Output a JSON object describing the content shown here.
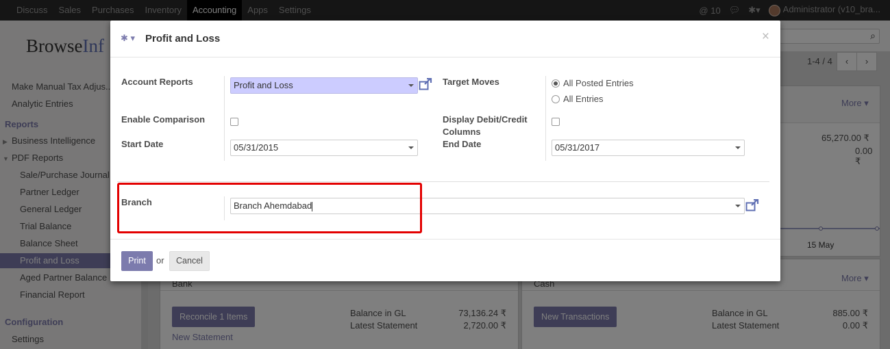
{
  "topbar": {
    "menu": [
      "Discuss",
      "Sales",
      "Purchases",
      "Inventory",
      "Accounting",
      "Apps",
      "Settings"
    ],
    "active": "Accounting",
    "mentions": "10",
    "user": "Administrator (v10_bra..."
  },
  "sidebar": {
    "logo_a": "Browse",
    "logo_b": "Inf",
    "items": [
      {
        "label": "Make Manual Tax Adjus...",
        "kind": "l1"
      },
      {
        "label": "Analytic Entries",
        "kind": "l1"
      },
      {
        "label": "Reports",
        "kind": "sec"
      },
      {
        "label": "Business Intelligence",
        "kind": "l1c"
      },
      {
        "label": "PDF Reports",
        "kind": "l1o"
      },
      {
        "label": "Sale/Purchase Journal",
        "kind": "l2"
      },
      {
        "label": "Partner Ledger",
        "kind": "l2"
      },
      {
        "label": "General Ledger",
        "kind": "l2"
      },
      {
        "label": "Trial Balance",
        "kind": "l2"
      },
      {
        "label": "Balance Sheet",
        "kind": "l2"
      },
      {
        "label": "Profit and Loss",
        "kind": "l2",
        "active": true
      },
      {
        "label": "Aged Partner Balance",
        "kind": "l2"
      },
      {
        "label": "Financial Report",
        "kind": "l2"
      },
      {
        "label": "Configuration",
        "kind": "sec"
      },
      {
        "label": "Settings",
        "kind": "l1"
      }
    ]
  },
  "main": {
    "pager": "1-4 / 4",
    "more": "More",
    "card_top_right": {
      "amount1": "65,270.00 ₹",
      "amount2": "0.00 ₹",
      "axis_label": "15 May"
    },
    "bank": {
      "title": "Bank",
      "button": "Reconcile 1 Items",
      "link": "New Statement",
      "label1": "Balance in GL",
      "value1": "73,136.24 ₹",
      "label2": "Latest Statement",
      "value2": "2,720.00 ₹"
    },
    "cash": {
      "title": "Cash",
      "button": "New Transactions",
      "label1": "Balance in GL",
      "value1": "885.00 ₹",
      "label2": "Latest Statement",
      "value2": "0.00 ₹"
    }
  },
  "modal": {
    "title": "Profit and Loss",
    "account_reports_label": "Account Reports",
    "account_reports_value": "Profit and Loss",
    "target_moves_label": "Target Moves",
    "target_moves_options": [
      "All Posted Entries",
      "All Entries"
    ],
    "target_moves_selected": "All Posted Entries",
    "enable_comparison_label": "Enable Comparison",
    "enable_comparison_checked": false,
    "display_debit_credit_label": "Display Debit/Credit Columns",
    "display_debit_credit_checked": false,
    "start_date_label": "Start Date",
    "start_date_value": "05/31/2015",
    "end_date_label": "End Date",
    "end_date_value": "05/31/2017",
    "branch_label": "Branch",
    "branch_value": "Branch Ahemdabad",
    "print_label": "Print",
    "or_label": "or",
    "cancel_label": "Cancel",
    "highlight_color": "#e30000",
    "accent_color": "#7c7bad"
  }
}
